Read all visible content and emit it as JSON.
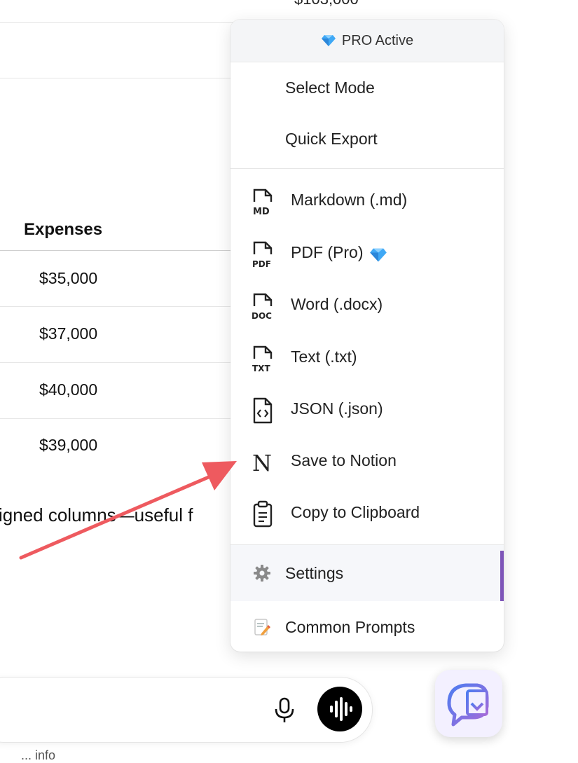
{
  "background": {
    "top_amount": "$103,000",
    "column_header": "Expenses",
    "rows": [
      "$35,000",
      "$37,000",
      "$40,000",
      "$39,000"
    ],
    "paragraph_fragment": "igned columns—useful f",
    "footer_hint": "... info"
  },
  "menu": {
    "pro_status": "PRO Active",
    "mode_items": [
      "Select Mode",
      "Quick Export"
    ],
    "formats": [
      {
        "label": "Markdown (.md)",
        "tag": "MD"
      },
      {
        "label": "PDF (Pro)",
        "tag": "PDF"
      },
      {
        "label": "Word (.docx)",
        "tag": "DOC"
      },
      {
        "label": "Text (.txt)",
        "tag": "TXT"
      },
      {
        "label": "JSON (.json)",
        "tag": "<>"
      },
      {
        "label": "Save to Notion",
        "tag": "N"
      },
      {
        "label": "Copy to Clipboard",
        "tag": ""
      }
    ],
    "settings_label": "Settings",
    "common_prompts_label": "Common Prompts"
  },
  "colors": {
    "accent": "#7e55b8",
    "arrow": "#ee5a5f",
    "diamond": "#3fa8f5"
  }
}
